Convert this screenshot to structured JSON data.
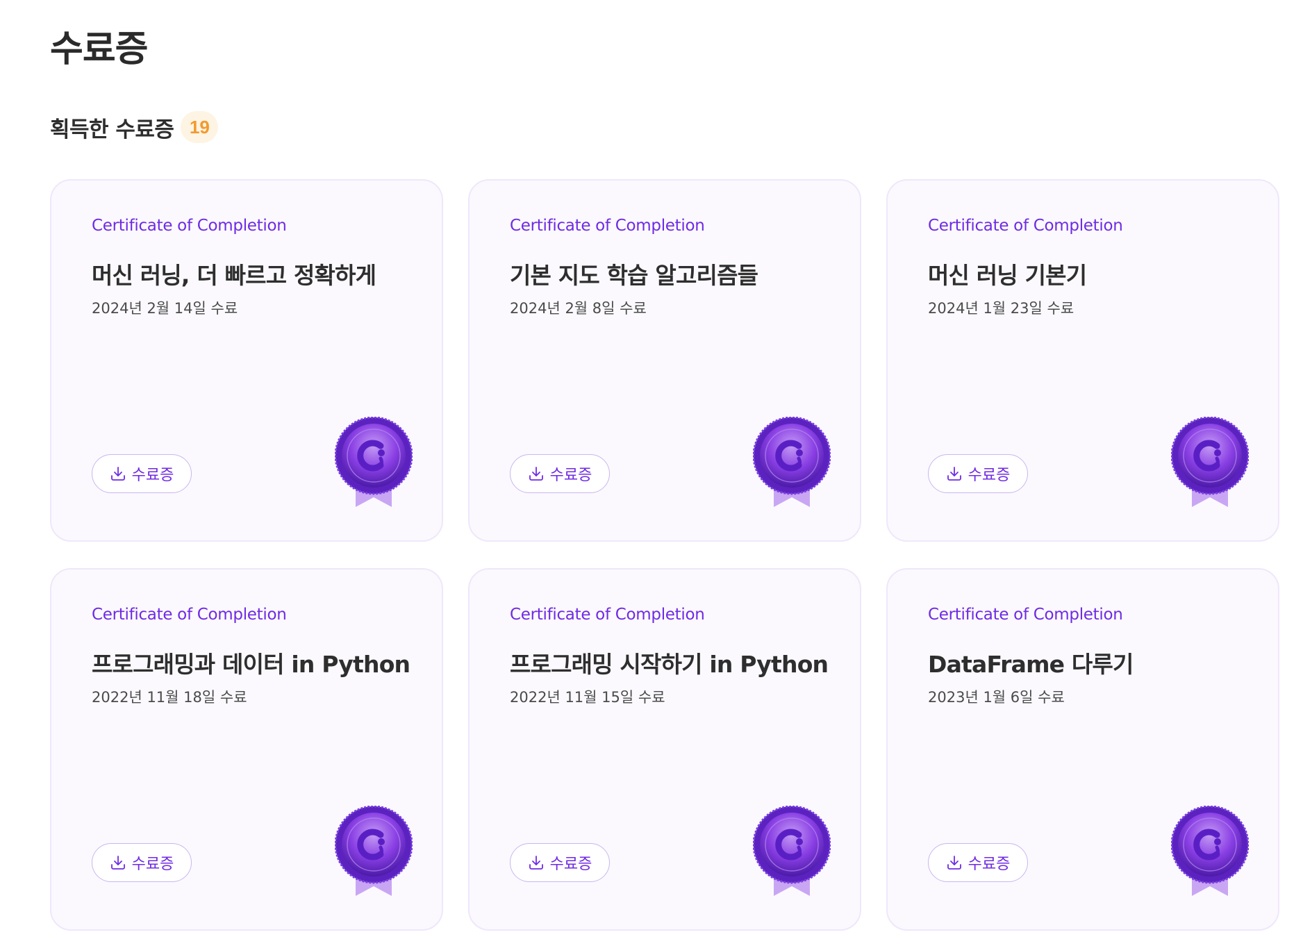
{
  "page": {
    "title": "수료증"
  },
  "section": {
    "title": "획득한 수료증",
    "count": "19"
  },
  "colors": {
    "accent": "#6f2be3",
    "badge_bg": "#fef4e4",
    "badge_text": "#f29a2e",
    "card_bg": "#fbf9fe",
    "card_border": "#efe7fb"
  },
  "certificates": [
    {
      "label": "Certificate of Completion",
      "title": "머신 러닝, 더 빠르고 정확하게",
      "date": "2024년 2월 14일 수료",
      "button_label": "수료증",
      "button_icon": "download-icon",
      "medal_icon": "medal-icon"
    },
    {
      "label": "Certificate of Completion",
      "title": "기본 지도 학습 알고리즘들",
      "date": "2024년 2월 8일 수료",
      "button_label": "수료증",
      "button_icon": "download-icon",
      "medal_icon": "medal-icon"
    },
    {
      "label": "Certificate of Completion",
      "title": "머신 러닝 기본기",
      "date": "2024년 1월 23일 수료",
      "button_label": "수료증",
      "button_icon": "download-icon",
      "medal_icon": "medal-icon"
    },
    {
      "label": "Certificate of Completion",
      "title": "프로그래밍과 데이터 in Python",
      "date": "2022년 11월 18일 수료",
      "button_label": "수료증",
      "button_icon": "download-icon",
      "medal_icon": "medal-icon"
    },
    {
      "label": "Certificate of Completion",
      "title": "프로그래밍 시작하기 in Python",
      "date": "2022년 11월 15일 수료",
      "button_label": "수료증",
      "button_icon": "download-icon",
      "medal_icon": "medal-icon"
    },
    {
      "label": "Certificate of Completion",
      "title": "DataFrame 다루기",
      "date": "2023년 1월 6일 수료",
      "button_label": "수료증",
      "button_icon": "download-icon",
      "medal_icon": "medal-icon"
    }
  ]
}
